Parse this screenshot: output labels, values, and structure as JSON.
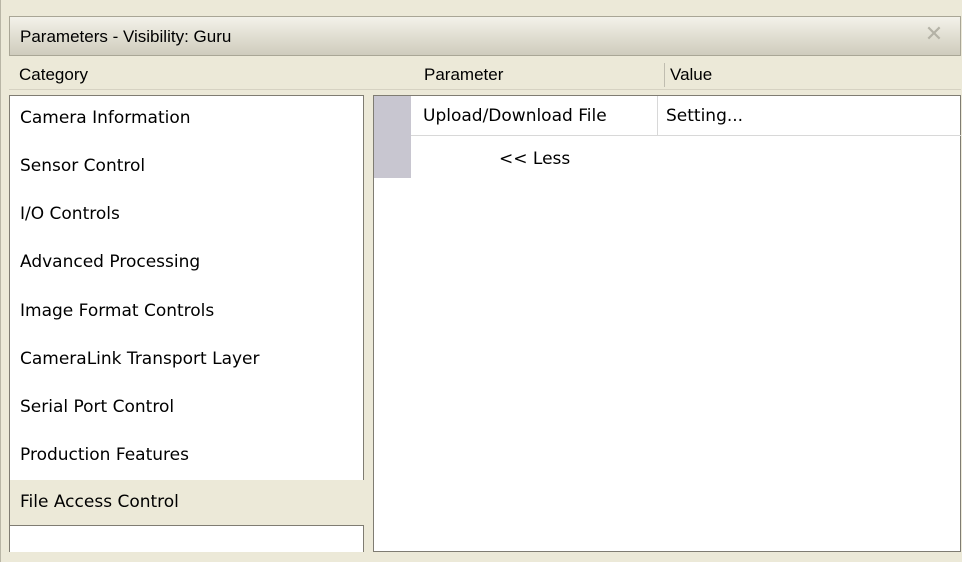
{
  "window": {
    "title": "Parameters - Visibility: Guru",
    "close_glyph": "✕"
  },
  "headers": {
    "category": "Category",
    "parameter": "Parameter",
    "value": "Value"
  },
  "categories": [
    "Camera Information",
    "Sensor Control",
    "I/O Controls",
    "Advanced Processing",
    "Image Format Controls",
    "CameraLink Transport Layer",
    "Serial Port Control",
    "Production Features",
    "File Access Control"
  ],
  "selected_category": "File Access Control",
  "parameters": [
    {
      "name": "Upload/Download File",
      "value": "Setting..."
    }
  ],
  "less_link": "<< Less",
  "colors": {
    "background": "#ece9d8",
    "gutter": "#c8c6d0"
  },
  "icons": {
    "close": "close-icon"
  }
}
